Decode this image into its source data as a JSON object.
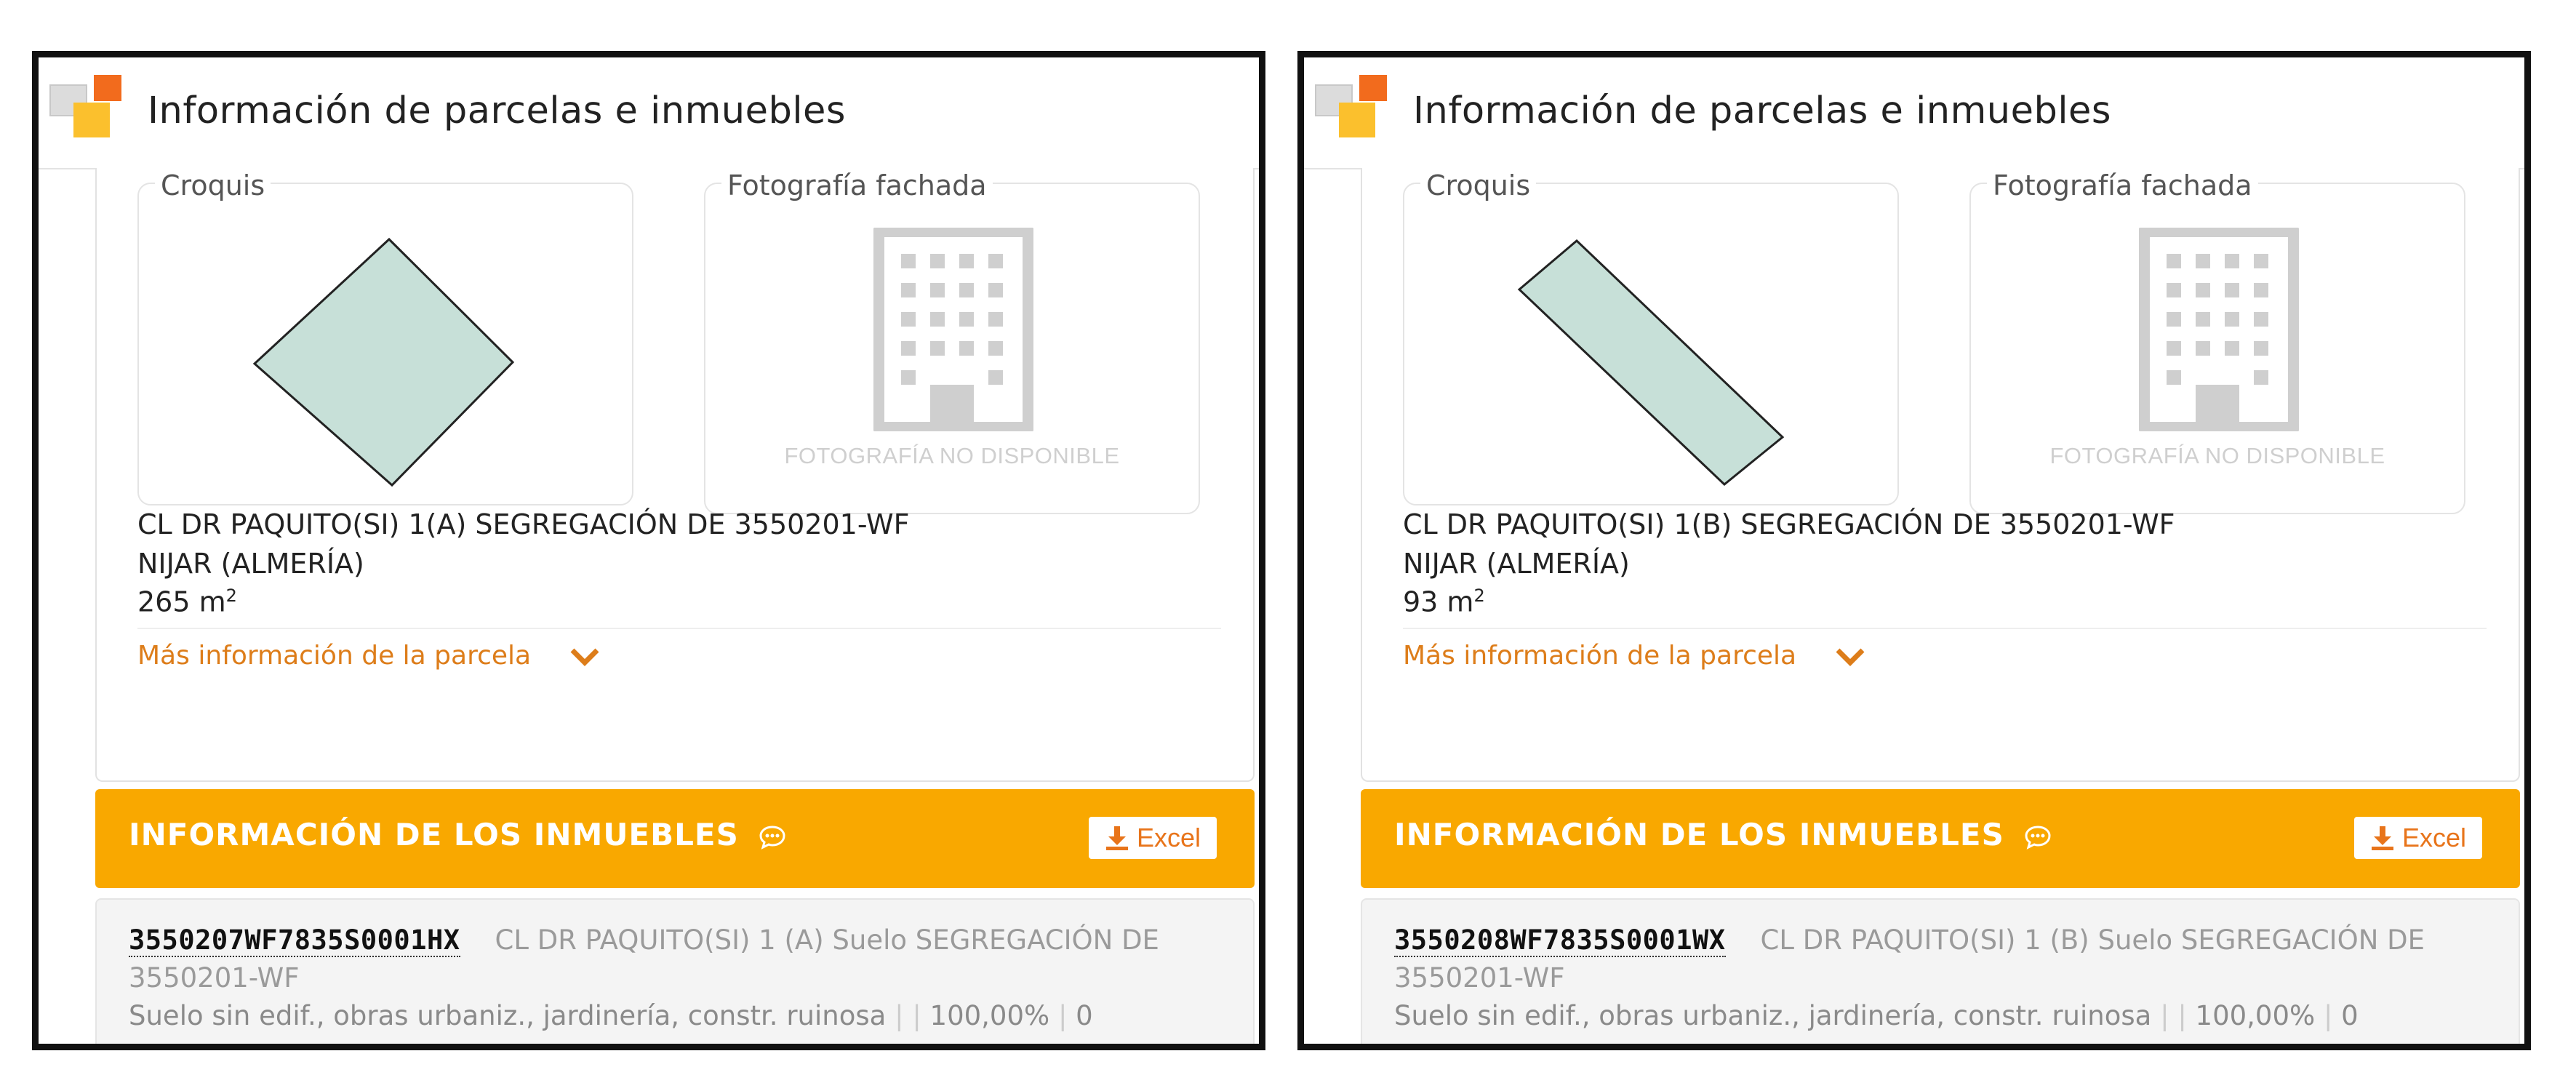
{
  "colors": {
    "accent_orange": "#f9a800",
    "link_orange": "#dd7d1a",
    "parcel_fill": "#c7e0d8",
    "logo_orange": "#f26b1d",
    "logo_yellow": "#fbc02d",
    "logo_gray": "#dcdcdc"
  },
  "panels": [
    {
      "header_title": "Información de parcelas e inmuebles",
      "sketch_label": "Croquis",
      "photo_label": "Fotografía fachada",
      "photo_placeholder": "FOTOGRAFÍA NO DISPONIBLE",
      "address_line1": "CL DR PAQUITO(SI) 1(A) SEGREGACIÓN DE 3550201-WF",
      "address_line2": "NIJAR (ALMERÍA)",
      "area_value": "265 m",
      "area_unit_sup": "2",
      "more_info_link": "Más información de la parcela",
      "section_title": "INFORMACIÓN DE LOS INMUEBLES",
      "excel_label": "Excel",
      "property_ref": "3550207WF7835S0001HX",
      "property_desc": "CL DR PAQUITO(SI) 1 (A) Suelo SEGREGACIÓN DE 3550201-WF",
      "property_use": "Suelo sin edif., obras urbaniz., jardinería, constr. ruinosa",
      "property_pct": "100,00%",
      "property_last": "0"
    },
    {
      "header_title": "Información de parcelas e inmuebles",
      "sketch_label": "Croquis",
      "photo_label": "Fotografía fachada",
      "photo_placeholder": "FOTOGRAFÍA NO DISPONIBLE",
      "address_line1": "CL DR PAQUITO(SI) 1(B) SEGREGACIÓN DE 3550201-WF",
      "address_line2": "NIJAR (ALMERÍA)",
      "area_value": "93 m",
      "area_unit_sup": "2",
      "more_info_link": "Más información de la parcela",
      "section_title": "INFORMACIÓN DE LOS INMUEBLES",
      "excel_label": "Excel",
      "property_ref": "3550208WF7835S0001WX",
      "property_desc": "CL DR PAQUITO(SI) 1 (B) Suelo SEGREGACIÓN DE 3550201-WF",
      "property_use": "Suelo sin edif., obras urbaniz., jardinería, constr. ruinosa",
      "property_pct": "100,00%",
      "property_last": "0"
    }
  ]
}
